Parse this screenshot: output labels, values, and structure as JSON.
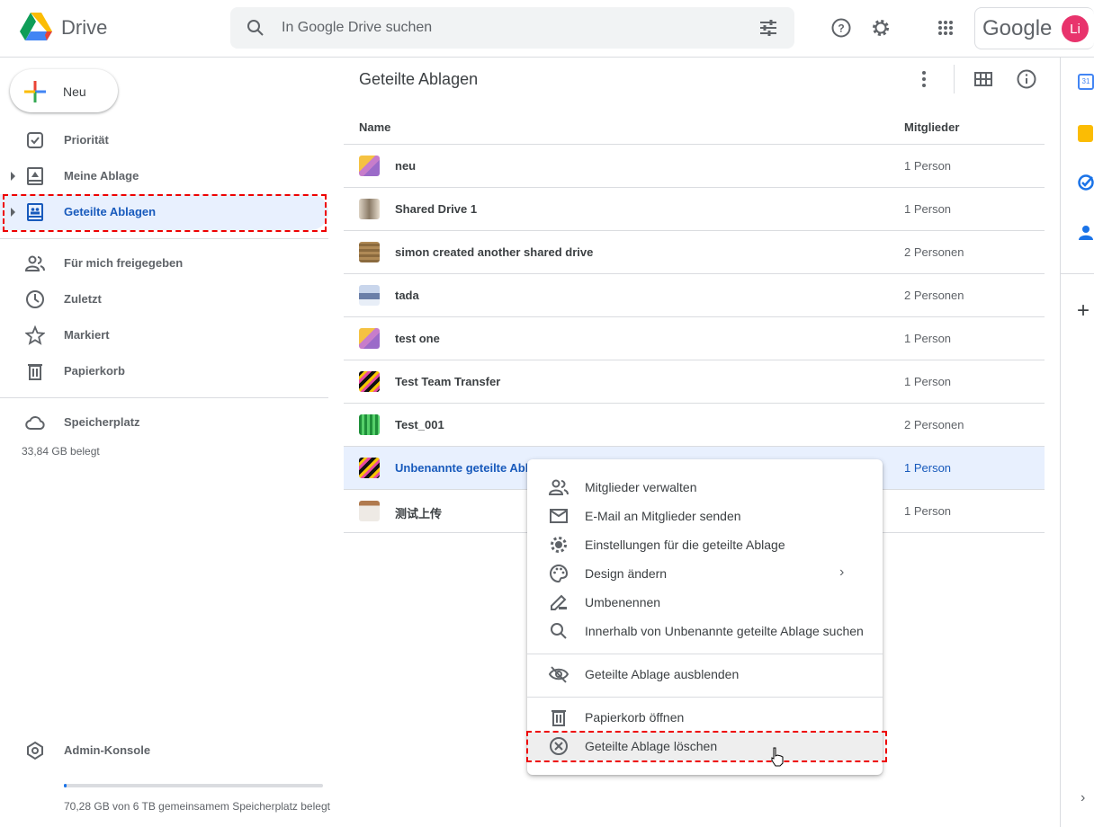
{
  "app": {
    "name": "Drive",
    "search_placeholder": "In Google Drive suchen",
    "account_brand": "Google",
    "avatar_initials": "Li"
  },
  "sidebar": {
    "new_label": "Neu",
    "items": [
      {
        "label": "Priorität"
      },
      {
        "label": "Meine Ablage"
      },
      {
        "label": "Geteilte Ablagen"
      },
      {
        "label": "Für mich freigegeben"
      },
      {
        "label": "Zuletzt"
      },
      {
        "label": "Markiert"
      },
      {
        "label": "Papierkorb"
      }
    ],
    "storage_label": "Speicherplatz",
    "storage_used": "33,84 GB belegt",
    "admin_label": "Admin-Konsole",
    "shared_storage_text": "70,28 GB von 6 TB gemeinsamem Speicherplatz belegt",
    "shared_storage_fraction": 0.012
  },
  "main": {
    "title": "Geteilte Ablagen",
    "columns": {
      "name": "Name",
      "members": "Mitglieder"
    },
    "rows": [
      {
        "name": "neu",
        "members": "1 Person"
      },
      {
        "name": "Shared Drive 1",
        "members": "1 Person"
      },
      {
        "name": "simon created another shared drive",
        "members": "2 Personen"
      },
      {
        "name": "tada",
        "members": "2 Personen"
      },
      {
        "name": "test one",
        "members": "1 Person"
      },
      {
        "name": "Test Team Transfer",
        "members": "1 Person"
      },
      {
        "name": "Test_001",
        "members": "2 Personen"
      },
      {
        "name": "Unbenannte geteilte Ablage",
        "members": "1 Person"
      },
      {
        "name": "测试上传",
        "members": "1 Person"
      }
    ]
  },
  "context_menu": {
    "items": [
      {
        "label": "Mitglieder verwalten"
      },
      {
        "label": "E-Mail an Mitglieder senden"
      },
      {
        "label": "Einstellungen für die geteilte Ablage"
      },
      {
        "label": "Design ändern"
      },
      {
        "label": "Umbenennen"
      },
      {
        "label": "Innerhalb von Unbenannte geteilte Ablage suchen"
      },
      {
        "label": "Geteilte Ablage ausblenden"
      },
      {
        "label": "Papierkorb öffnen"
      },
      {
        "label": "Geteilte Ablage löschen"
      }
    ]
  },
  "colors": {
    "accent": "#185abc",
    "highlight": "#e8f0fe",
    "annotation": "#ee0000"
  }
}
